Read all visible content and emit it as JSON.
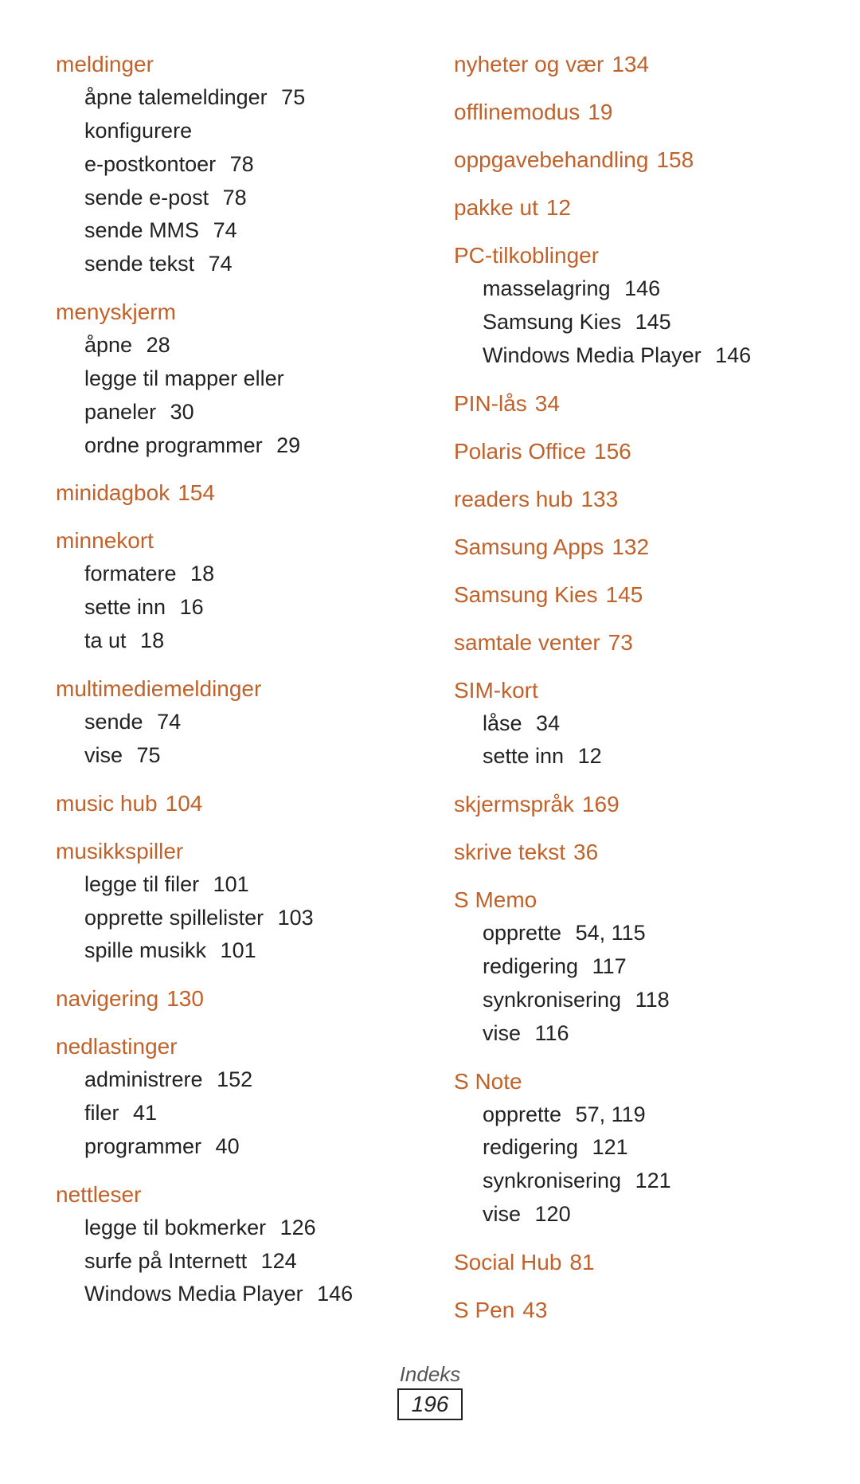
{
  "left_column": [
    {
      "type": "header",
      "text": "meldinger",
      "page": null,
      "sub_entries": [
        {
          "text": "åpne talemeldinger",
          "page": "75"
        },
        {
          "text": "konfigurere\ne-postkontoer",
          "page": "78"
        },
        {
          "text": "sende e-post",
          "page": "78"
        },
        {
          "text": "sende MMS",
          "page": "74"
        },
        {
          "text": "sende tekst",
          "page": "74"
        }
      ]
    },
    {
      "type": "header",
      "text": "menyskjerm",
      "page": null,
      "sub_entries": [
        {
          "text": "åpne",
          "page": "28"
        },
        {
          "text": "legge til mapper eller\npaneler",
          "page": "30"
        },
        {
          "text": "ordne programmer",
          "page": "29"
        }
      ]
    },
    {
      "type": "header",
      "text": "minidagbok",
      "page": "154",
      "sub_entries": []
    },
    {
      "type": "header",
      "text": "minnekort",
      "page": null,
      "sub_entries": [
        {
          "text": "formatere",
          "page": "18"
        },
        {
          "text": "sette inn",
          "page": "16"
        },
        {
          "text": "ta ut",
          "page": "18"
        }
      ]
    },
    {
      "type": "header",
      "text": "multimediemeldinger",
      "page": null,
      "sub_entries": [
        {
          "text": "sende",
          "page": "74"
        },
        {
          "text": "vise",
          "page": "75"
        }
      ]
    },
    {
      "type": "header",
      "text": "music hub",
      "page": "104",
      "sub_entries": []
    },
    {
      "type": "header",
      "text": "musikkspiller",
      "page": null,
      "sub_entries": [
        {
          "text": "legge til filer",
          "page": "101"
        },
        {
          "text": "opprette spillelister",
          "page": "103"
        },
        {
          "text": "spille musikk",
          "page": "101"
        }
      ]
    },
    {
      "type": "header",
      "text": "navigering",
      "page": "130",
      "sub_entries": []
    },
    {
      "type": "header",
      "text": "nedlastinger",
      "page": null,
      "sub_entries": [
        {
          "text": "administrere",
          "page": "152"
        },
        {
          "text": "filer",
          "page": "41"
        },
        {
          "text": "programmer",
          "page": "40"
        }
      ]
    },
    {
      "type": "header",
      "text": "nettleser",
      "page": null,
      "sub_entries": [
        {
          "text": "legge til bokmerker",
          "page": "126"
        },
        {
          "text": "surfe på Internett",
          "page": "124"
        },
        {
          "text": "Windows Media Player",
          "page": "146"
        }
      ]
    }
  ],
  "right_column": [
    {
      "type": "plain",
      "text": "nyheter og vær",
      "page": "134",
      "sub_entries": []
    },
    {
      "type": "header",
      "text": "offlinemodus",
      "page": "19",
      "sub_entries": []
    },
    {
      "type": "header",
      "text": "oppgavebehandling",
      "page": "158",
      "sub_entries": []
    },
    {
      "type": "plain",
      "text": "pakke ut",
      "page": "12",
      "sub_entries": []
    },
    {
      "type": "header",
      "text": "PC-tilkoblinger",
      "page": null,
      "sub_entries": [
        {
          "text": "masselagring",
          "page": "146"
        },
        {
          "text": "Samsung Kies",
          "page": "145"
        },
        {
          "text": "Windows Media Player",
          "page": "146"
        }
      ]
    },
    {
      "type": "plain",
      "text": "PIN-lås",
      "page": "34",
      "sub_entries": []
    },
    {
      "type": "header",
      "text": "Polaris Office",
      "page": "156",
      "sub_entries": []
    },
    {
      "type": "plain",
      "text": "readers hub",
      "page": "133",
      "sub_entries": []
    },
    {
      "type": "header",
      "text": "Samsung Apps",
      "page": "132",
      "sub_entries": []
    },
    {
      "type": "header",
      "text": "Samsung Kies",
      "page": "145",
      "sub_entries": []
    },
    {
      "type": "header",
      "text": "samtale venter",
      "page": "73",
      "sub_entries": []
    },
    {
      "type": "header",
      "text": "SIM-kort",
      "page": null,
      "sub_entries": [
        {
          "text": "låse",
          "page": "34"
        },
        {
          "text": "sette inn",
          "page": "12"
        }
      ]
    },
    {
      "type": "header",
      "text": "skjermspråk",
      "page": "169",
      "sub_entries": []
    },
    {
      "type": "plain",
      "text": "skrive tekst",
      "page": "36",
      "sub_entries": []
    },
    {
      "type": "header",
      "text": "S Memo",
      "page": null,
      "sub_entries": [
        {
          "text": "opprette",
          "page": "54, 115"
        },
        {
          "text": "redigering",
          "page": "117"
        },
        {
          "text": "synkronisering",
          "page": "118"
        },
        {
          "text": "vise",
          "page": "116"
        }
      ]
    },
    {
      "type": "header",
      "text": "S Note",
      "page": null,
      "sub_entries": [
        {
          "text": "opprette",
          "page": "57, 119"
        },
        {
          "text": "redigering",
          "page": "121"
        },
        {
          "text": "synkronisering",
          "page": "121"
        },
        {
          "text": "vise",
          "page": "120"
        }
      ]
    },
    {
      "type": "header",
      "text": "Social Hub",
      "page": "81",
      "sub_entries": []
    },
    {
      "type": "plain",
      "text": "S Pen",
      "page": "43",
      "sub_entries": []
    }
  ],
  "footer": {
    "label": "Indeks",
    "page": "196"
  }
}
